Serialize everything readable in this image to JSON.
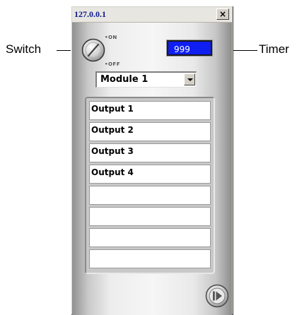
{
  "annotations": {
    "switch_label": "Switch",
    "timer_label": "Timer"
  },
  "window": {
    "title": "127.0.0.1",
    "close_glyph": "×"
  },
  "switch": {
    "on_label": "•ON",
    "off_label": "•OFF",
    "icon": "rotary-knob-icon"
  },
  "timer": {
    "value": "999",
    "color": "#0f1ff2"
  },
  "module_select": {
    "selected": "Module 1"
  },
  "outputs": [
    {
      "label": "Output 1"
    },
    {
      "label": "Output 2"
    },
    {
      "label": "Output 3"
    },
    {
      "label": "Output 4"
    },
    {
      "label": ""
    },
    {
      "label": ""
    },
    {
      "label": ""
    },
    {
      "label": ""
    }
  ],
  "play_button": {
    "icon": "play-pause-icon"
  }
}
